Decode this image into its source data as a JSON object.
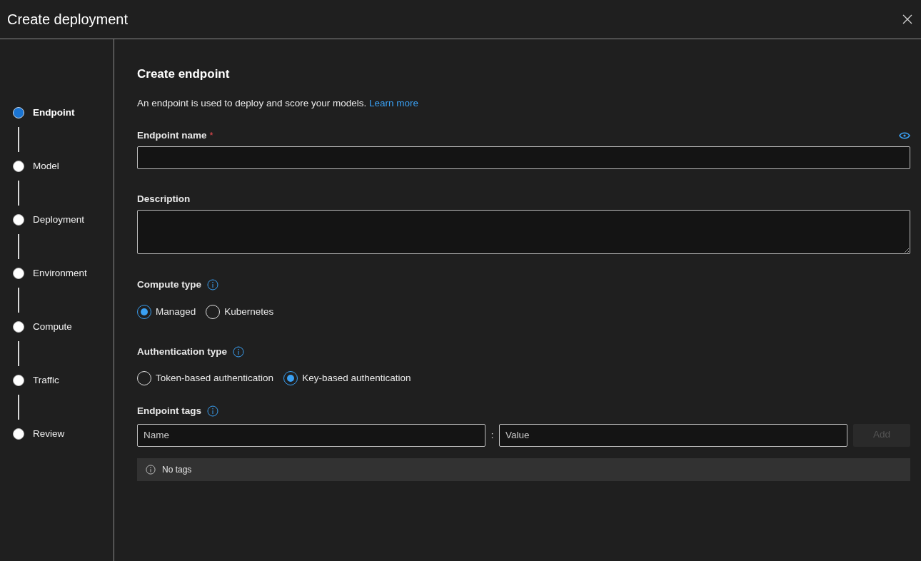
{
  "window": {
    "title": "Create deployment"
  },
  "steps": [
    {
      "label": "Endpoint",
      "selected": true
    },
    {
      "label": "Model",
      "selected": false
    },
    {
      "label": "Deployment",
      "selected": false
    },
    {
      "label": "Environment",
      "selected": false
    },
    {
      "label": "Compute",
      "selected": false
    },
    {
      "label": "Traffic",
      "selected": false
    },
    {
      "label": "Review",
      "selected": false
    }
  ],
  "form": {
    "heading": "Create endpoint",
    "intro": "An endpoint is used to deploy and score your models.",
    "learn_more": "Learn more",
    "endpoint_name": {
      "label": "Endpoint name",
      "required_mark": "*"
    },
    "description": {
      "label": "Description"
    },
    "compute_type": {
      "label": "Compute type",
      "options": [
        {
          "label": "Managed",
          "selected": true
        },
        {
          "label": "Kubernetes",
          "selected": false
        }
      ]
    },
    "authentication_type": {
      "label": "Authentication type",
      "options": [
        {
          "label": "Token-based authentication",
          "selected": false
        },
        {
          "label": "Key-based authentication",
          "selected": true
        }
      ]
    },
    "endpoint_tags": {
      "label": "Endpoint tags",
      "name_placeholder": "Name",
      "separator": ":",
      "value_placeholder": "Value",
      "add_button": {
        "label": "Add",
        "disabled": true
      },
      "empty_message": "No tags"
    }
  }
}
